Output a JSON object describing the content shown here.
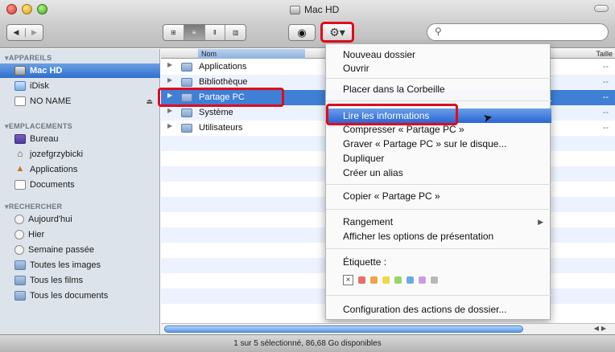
{
  "window": {
    "title": "Mac HD"
  },
  "toolbar": {
    "back": "◀",
    "forward": "▶",
    "view_icons": "⊞",
    "view_list": "≡",
    "view_columns": "Ⅱ",
    "view_coverflow": "▥",
    "quicklook": "◉",
    "action": "⚙▾",
    "search_icon": "⚲",
    "search_placeholder": ""
  },
  "sidebar": {
    "sections": [
      {
        "title": "APPAREILS",
        "items": [
          "Mac HD",
          "iDisk",
          "NO NAME"
        ]
      },
      {
        "title": "EMPLACEMENTS",
        "items": [
          "Bureau",
          "jozefgrzybicki",
          "Applications",
          "Documents"
        ]
      },
      {
        "title": "RECHERCHER",
        "items": [
          "Aujourd'hui",
          "Hier",
          "Semaine passée",
          "Toutes les images",
          "Tous les films",
          "Tous les documents"
        ]
      }
    ],
    "selected": "Mac HD"
  },
  "list": {
    "columns": {
      "name": "Nom",
      "size": "Taille"
    },
    "rows": [
      {
        "name": "Applications",
        "size": "--"
      },
      {
        "name": "Bibliothèque",
        "size": "--"
      },
      {
        "name": "Partage PC",
        "size": "--",
        "selected": true
      },
      {
        "name": "Système",
        "size": "--"
      },
      {
        "name": "Utilisateurs",
        "size": "--"
      }
    ]
  },
  "context_menu": {
    "items": [
      "Nouveau dossier",
      "Ouvrir",
      "Placer dans la Corbeille",
      "Lire les informations",
      "Compresser « Partage PC »",
      "Graver « Partage PC » sur le disque...",
      "Dupliquer",
      "Créer un alias",
      "Copier « Partage PC »",
      "Rangement",
      "Afficher les options de présentation",
      "Étiquette :",
      "Configuration des actions de dossier..."
    ],
    "active": "Lire les informations",
    "label_colors": [
      "#e8706a",
      "#f0a24a",
      "#efd94b",
      "#9bd46a",
      "#6ea8ec",
      "#c79ee6",
      "#b9b9b9"
    ],
    "submenu_arrow": "▶",
    "label_none": "×"
  },
  "status": {
    "text": "1 sur 5 sélectionné, 86,68 Go disponibles"
  },
  "colors": {
    "highlight_red": "#e00b1c",
    "selection_blue": "#3f7fd6"
  }
}
